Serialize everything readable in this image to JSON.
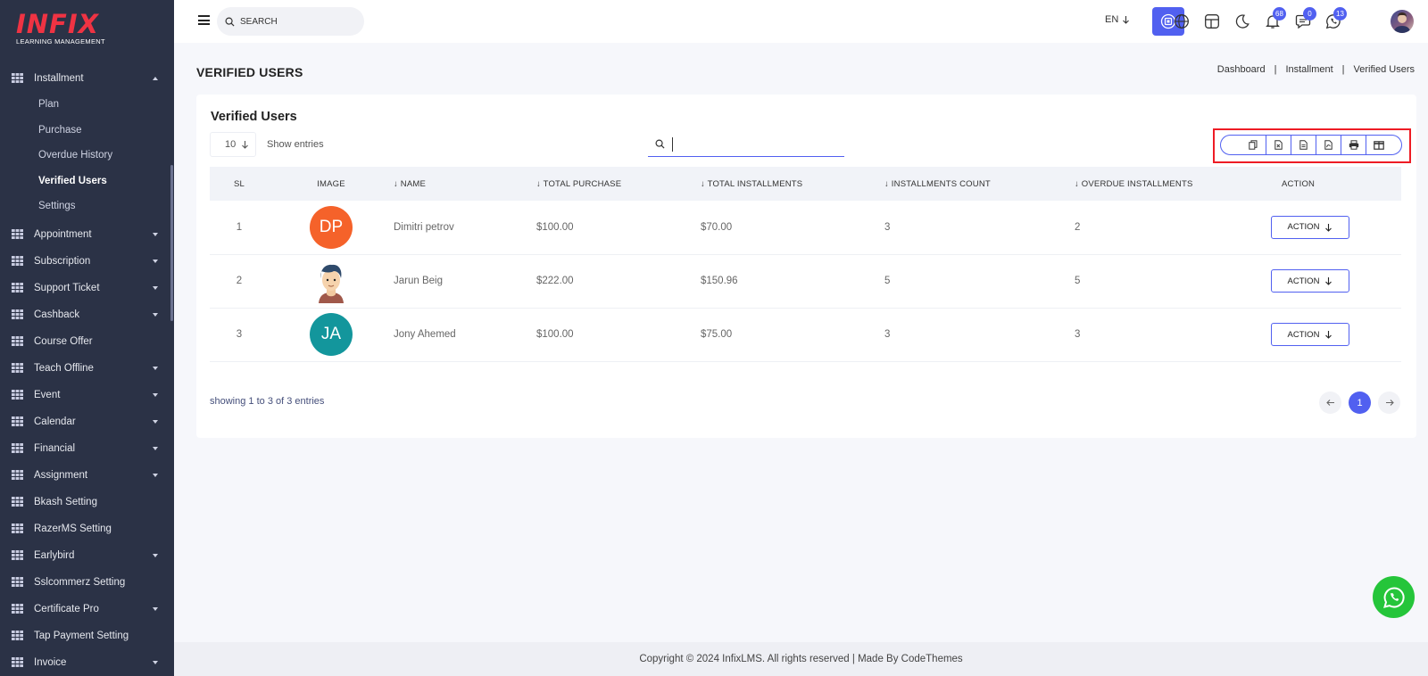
{
  "brand": {
    "name": "INFIX",
    "subtitle": "LEARNING MANAGEMENT"
  },
  "sidebar": {
    "items": [
      {
        "label": "Installment",
        "expanded": true,
        "has_caret": true,
        "children": [
          "Plan",
          "Purchase",
          "Overdue History",
          "Verified Users",
          "Settings"
        ],
        "active_child": "Verified Users"
      },
      {
        "label": "Appointment",
        "has_caret": true
      },
      {
        "label": "Subscription",
        "has_caret": true
      },
      {
        "label": "Support Ticket",
        "has_caret": true
      },
      {
        "label": "Cashback",
        "has_caret": true
      },
      {
        "label": "Course Offer",
        "has_caret": false
      },
      {
        "label": "Teach Offline",
        "has_caret": true
      },
      {
        "label": "Event",
        "has_caret": true
      },
      {
        "label": "Calendar",
        "has_caret": true
      },
      {
        "label": "Financial",
        "has_caret": true
      },
      {
        "label": "Assignment",
        "has_caret": true
      },
      {
        "label": "Bkash Setting",
        "has_caret": false
      },
      {
        "label": "RazerMS Setting",
        "has_caret": false
      },
      {
        "label": "Earlybird",
        "has_caret": true
      },
      {
        "label": "Sslcommerz Setting",
        "has_caret": false
      },
      {
        "label": "Certificate Pro",
        "has_caret": true
      },
      {
        "label": "Tap Payment Setting",
        "has_caret": false
      },
      {
        "label": "Invoice",
        "has_caret": true
      }
    ]
  },
  "topbar": {
    "search_placeholder": "SEARCH",
    "language": "EN",
    "notifications_count": "68",
    "messages_count": "0",
    "whatsapp_count": "13"
  },
  "page": {
    "title": "VERIFIED USERS",
    "breadcrumb": [
      "Dashboard",
      "Installment",
      "Verified Users"
    ]
  },
  "card": {
    "title": "Verified Users",
    "entries_value": "10",
    "entries_label": "Show entries",
    "columns": [
      "SL",
      "IMAGE",
      "NAME",
      "TOTAL PURCHASE",
      "TOTAL INSTALLMENTS",
      "INSTALLMENTS COUNT",
      "OVERDUE INSTALLMENTS",
      "ACTION"
    ],
    "rows": [
      {
        "sl": "1",
        "initials": "DP",
        "avatar_color": "#f5622a",
        "name": "Dimitri petrov",
        "total_purchase": "$100.00",
        "total_installments": "$70.00",
        "installments_count": "3",
        "overdue": "2",
        "action": "ACTION"
      },
      {
        "sl": "2",
        "initials": "",
        "avatar_color": "#ffffff",
        "name": "Jarun Beig",
        "total_purchase": "$222.00",
        "total_installments": "$150.96",
        "installments_count": "5",
        "overdue": "5",
        "action": "ACTION"
      },
      {
        "sl": "3",
        "initials": "JA",
        "avatar_color": "#13969c",
        "name": "Jony Ahemed",
        "total_purchase": "$100.00",
        "total_installments": "$75.00",
        "installments_count": "3",
        "overdue": "3",
        "action": "ACTION"
      }
    ],
    "showing": "showing 1 to 3 of 3 entries",
    "current_page": "1"
  },
  "footer": {
    "text": "Copyright © 2024 InfixLMS. All rights reserved | Made By CodeThemes"
  },
  "colors": {
    "accent": "#5160f0",
    "sidebar_bg": "#2b3246",
    "highlight": "#ee1c25",
    "whatsapp": "#25c53a"
  }
}
